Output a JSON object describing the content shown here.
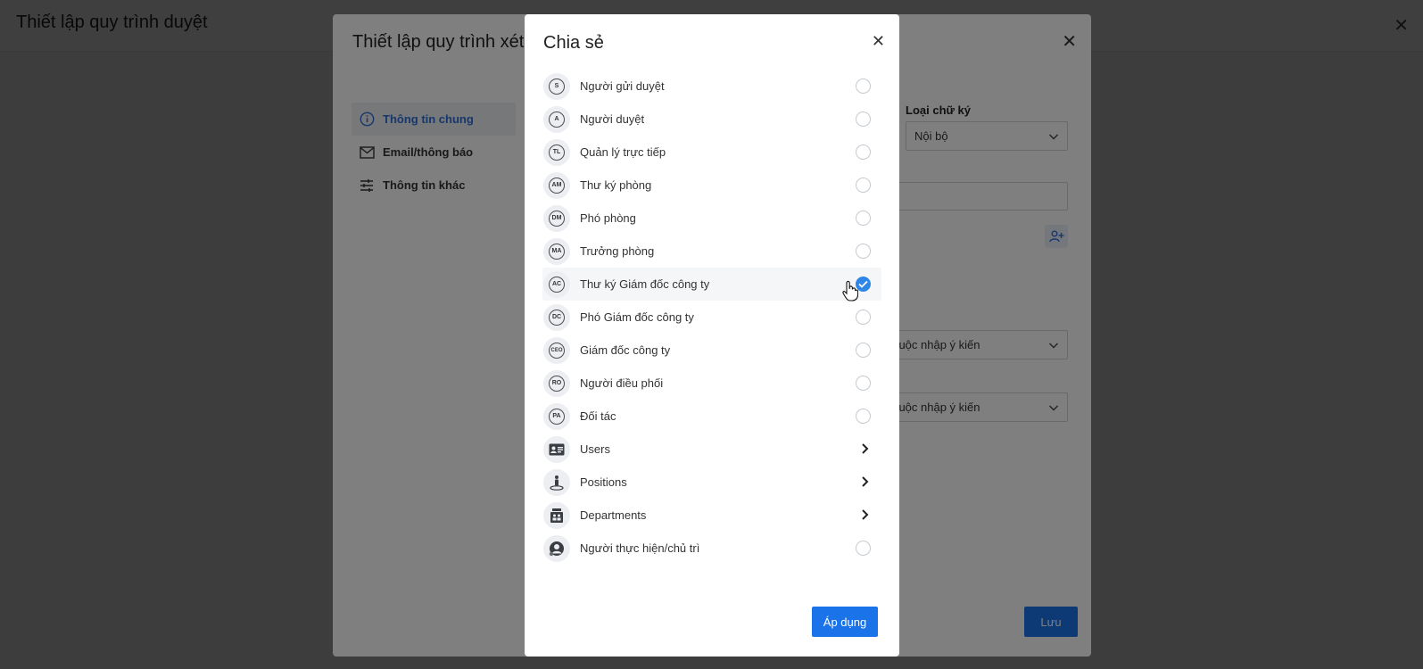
{
  "page": {
    "title": "Thiết lập quy trình duyệt"
  },
  "process_dialog": {
    "title": "Thiết lập quy trình xét",
    "nav": [
      {
        "label": "Thông tin chung"
      },
      {
        "label": "Email/thông báo"
      },
      {
        "label": "Thông tin khác"
      }
    ],
    "signature_label": "Loại chữ ký",
    "signature_value": "Nội bộ",
    "comment_select_1": "t buộc nhập ý kiến",
    "comment_select_2": "t buộc nhập ý kiến",
    "partial_label": "?",
    "save_label": "Lưu"
  },
  "share_dialog": {
    "title": "Chia sẻ",
    "items": [
      {
        "abbr": "S",
        "label": "Người gửi duyệt"
      },
      {
        "abbr": "A",
        "label": "Người duyệt"
      },
      {
        "abbr": "TL",
        "label": "Quản lý trực tiếp"
      },
      {
        "abbr": "AM",
        "label": "Thư ký phòng"
      },
      {
        "abbr": "DM",
        "label": "Phó phòng"
      },
      {
        "abbr": "MA",
        "label": "Trưởng phòng"
      },
      {
        "abbr": "AC",
        "label": "Thư ký Giám đốc công ty",
        "checked": true
      },
      {
        "abbr": "DC",
        "label": "Phó Giám đốc công ty"
      },
      {
        "abbr": "CEO",
        "label": "Giám đốc công ty"
      },
      {
        "abbr": "RO",
        "label": "Người điều phối"
      },
      {
        "abbr": "PA",
        "label": "Đối tác"
      },
      {
        "icon": "id-card-icon",
        "label": "Users"
      },
      {
        "icon": "position-person-icon",
        "label": "Positions"
      },
      {
        "icon": "department-icon",
        "label": "Departments"
      },
      {
        "icon": "user-circle-icon",
        "label": "Người thực hiện/chủ trì"
      }
    ],
    "apply_label": "Áp dụng"
  },
  "colors": {
    "primary": "#1a73e8",
    "check": "#2f86e6",
    "active_nav": "#2f6fd8"
  }
}
